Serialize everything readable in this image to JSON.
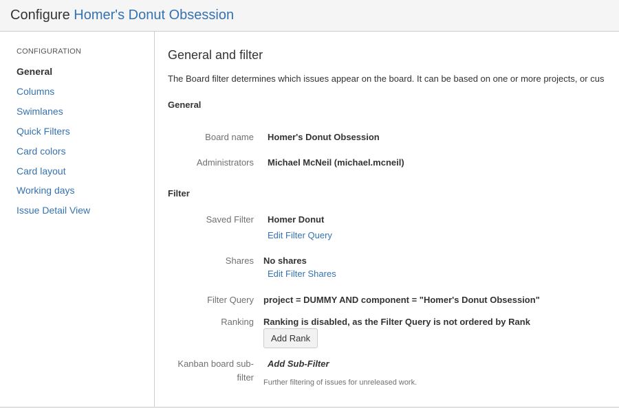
{
  "header": {
    "prefix": "Configure",
    "board_name": "Homer's Donut Obsession"
  },
  "sidebar": {
    "heading": "CONFIGURATION",
    "items": [
      {
        "label": "General",
        "active": true
      },
      {
        "label": "Columns",
        "active": false
      },
      {
        "label": "Swimlanes",
        "active": false
      },
      {
        "label": "Quick Filters",
        "active": false
      },
      {
        "label": "Card colors",
        "active": false
      },
      {
        "label": "Card layout",
        "active": false
      },
      {
        "label": "Working days",
        "active": false
      },
      {
        "label": "Issue Detail View",
        "active": false
      }
    ]
  },
  "main": {
    "title": "General and filter",
    "description": "The Board filter determines which issues appear on the board. It can be based on one or more projects, or cus",
    "general": {
      "heading": "General",
      "board_name_label": "Board name",
      "board_name_value": "Homer's Donut Obsession",
      "administrators_label": "Administrators",
      "administrators_value": "Michael McNeil (michael.mcneil)"
    },
    "filter": {
      "heading": "Filter",
      "saved_filter_label": "Saved Filter",
      "saved_filter_value": "Homer Donut",
      "edit_filter_query": "Edit Filter Query",
      "shares_label": "Shares",
      "shares_value": "No shares",
      "edit_filter_shares": "Edit Filter Shares",
      "filter_query_label": "Filter Query",
      "filter_query_value": "project = DUMMY AND component = \"Homer's Donut Obsession\"",
      "ranking_label": "Ranking",
      "ranking_value": "Ranking is disabled, as the Filter Query is not ordered by Rank",
      "add_rank_button": "Add Rank",
      "subfilter_label_line1": "Kanban board sub-",
      "subfilter_label_line2": "filter",
      "add_subfilter": "Add Sub-Filter",
      "subfilter_help": "Further filtering of issues for unreleased work."
    }
  },
  "colors": {
    "link": "#3572b0",
    "header_bg": "#f5f5f5",
    "border": "#cccccc"
  }
}
